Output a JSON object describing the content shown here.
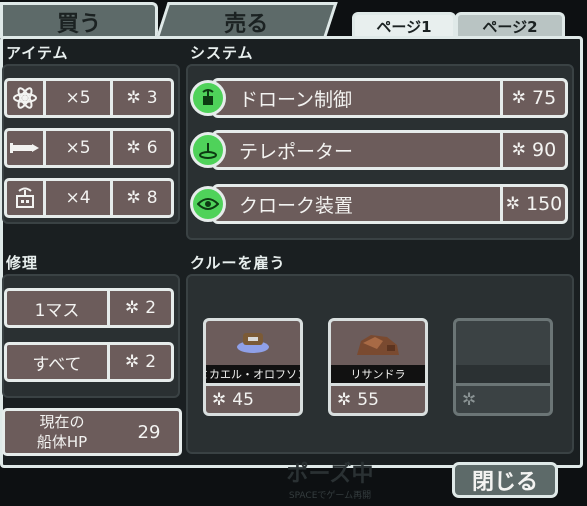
{
  "tabs": {
    "buy": "買う",
    "sell": "売る",
    "page1": "ページ1",
    "page2": "ページ2"
  },
  "sections": {
    "items": "アイテム",
    "systems": "システム",
    "repair": "修理",
    "crew": "クルーを雇う"
  },
  "items": [
    {
      "icon": "hacking-icon",
      "qty": "×5",
      "price": "3"
    },
    {
      "icon": "missile-icon",
      "qty": "×5",
      "price": "6"
    },
    {
      "icon": "drone-part-icon",
      "qty": "×4",
      "price": "8"
    }
  ],
  "systems": [
    {
      "icon": "drone-control-icon",
      "name": "ドローン制御",
      "price": "75"
    },
    {
      "icon": "teleporter-icon",
      "name": "テレポーター",
      "price": "90"
    },
    {
      "icon": "cloaking-icon",
      "name": "クローク装置",
      "price": "150"
    }
  ],
  "repair": [
    {
      "label": "1マス",
      "price": "2"
    },
    {
      "label": "すべて",
      "price": "2"
    }
  ],
  "hull": {
    "label_line1": "現在の",
    "label_line2": "船体HP",
    "value": "29"
  },
  "crew": [
    {
      "name": "ミカエル・オロフソン",
      "price": "45",
      "race": "engi"
    },
    {
      "name": "リサンドラ",
      "price": "55",
      "race": "rockman"
    },
    {
      "name": "",
      "price": "",
      "race": "empty"
    }
  ],
  "close_label": "閉じる",
  "background_text": "ポーズ中",
  "background_subtext": "SPACEでゲーム再開",
  "colors": {
    "button_brown": "#6c5c5b",
    "border_light": "#e6eceb",
    "system_green": "#4fd25a",
    "frame_dark": "#1a1f21"
  }
}
